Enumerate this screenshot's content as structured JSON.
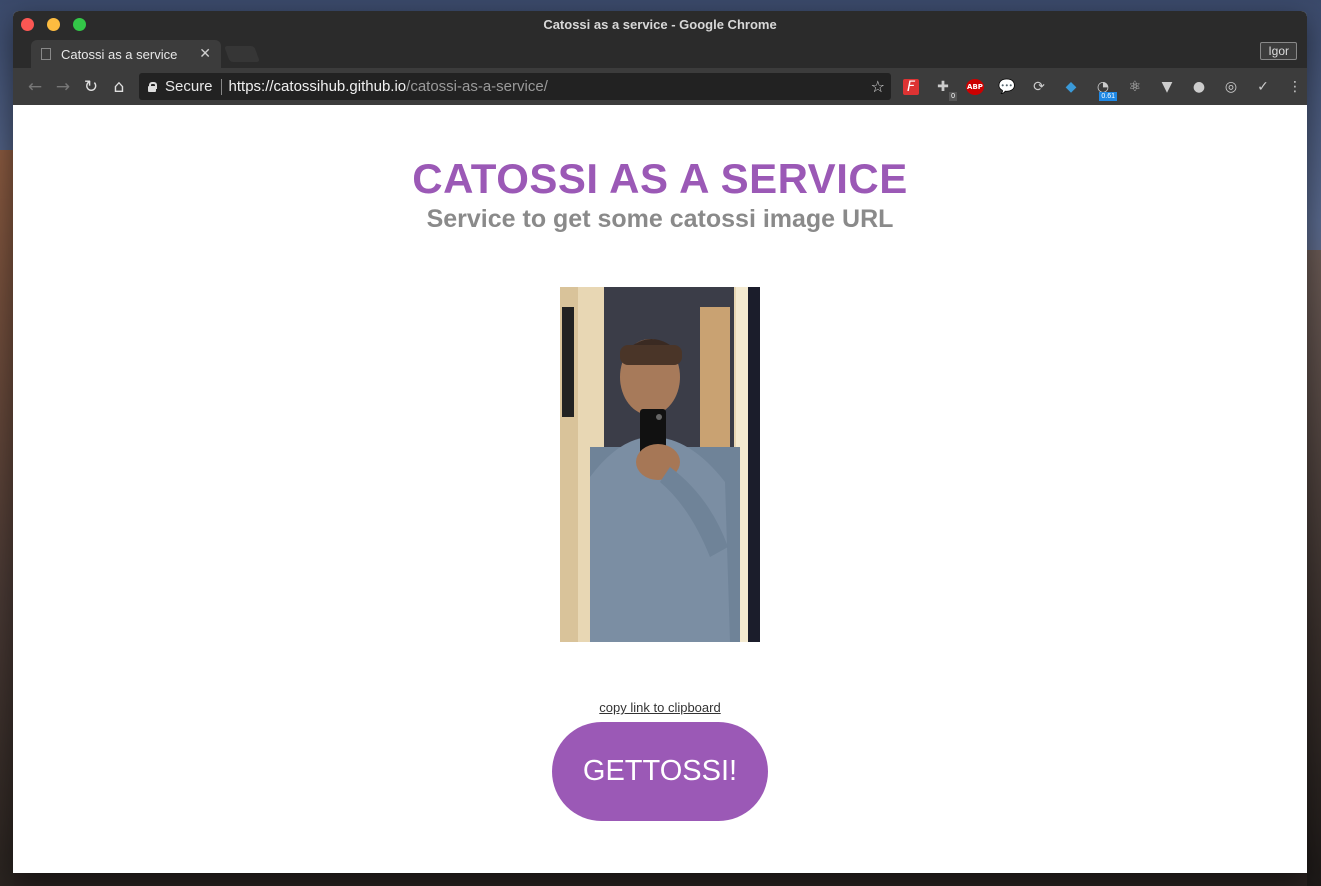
{
  "window": {
    "title": "Catossi as a service - Google Chrome"
  },
  "tabs": [
    {
      "title": "Catossi as a service"
    }
  ],
  "profile": {
    "name": "Igor"
  },
  "omnibox": {
    "secure_label": "Secure",
    "url_host": "https://catossihub.github.io",
    "url_path": "/catossi-as-a-service/"
  },
  "extensions": [
    {
      "name": "feedly-icon",
      "glyph": "F",
      "color": "#e33"
    },
    {
      "name": "extension-puzzle-icon",
      "glyph": "✚",
      "badge": "0",
      "badge_color": "#555"
    },
    {
      "name": "adblock-plus-icon",
      "glyph": "ABP",
      "color": "#c00"
    },
    {
      "name": "speech-bubble-icon",
      "glyph": "💬"
    },
    {
      "name": "sync-icon",
      "glyph": "⟳"
    },
    {
      "name": "gem-icon",
      "glyph": "◆",
      "color": "#3a9ad9"
    },
    {
      "name": "speed-gauge-icon",
      "glyph": "◔",
      "badge": "0.61",
      "badge_color": "#1e88e5"
    },
    {
      "name": "react-devtools-icon",
      "glyph": "⚛"
    },
    {
      "name": "vue-devtools-icon",
      "glyph": "▼"
    },
    {
      "name": "circle-extension-icon",
      "glyph": "●"
    },
    {
      "name": "target-icon",
      "glyph": "◎"
    },
    {
      "name": "checkmark-icon",
      "glyph": "✓"
    },
    {
      "name": "chrome-menu-icon",
      "glyph": "⋮"
    }
  ],
  "page": {
    "heading": "CATOSSI AS A SERVICE",
    "subheading": "Service to get some catossi image URL",
    "copy_link": "copy link to clipboard",
    "button": "GETTOSSI!",
    "accent_color": "#9b59b6"
  }
}
